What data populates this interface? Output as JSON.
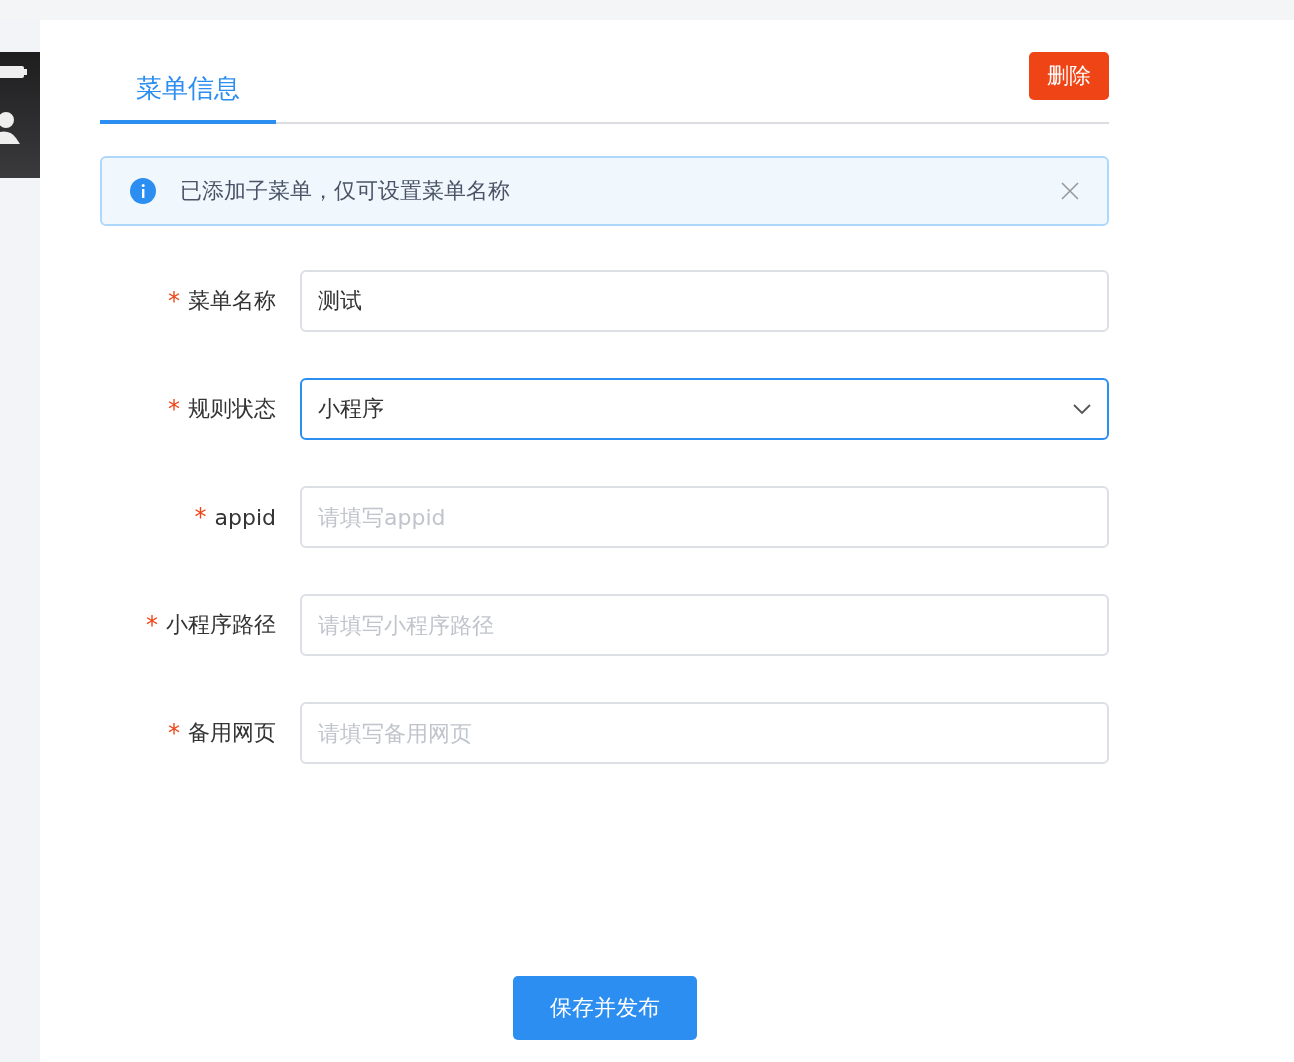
{
  "tabs": [
    {
      "label": "菜单信息",
      "selected": true
    }
  ],
  "delete_button": "删除",
  "alert": {
    "text": "已添加子菜单，仅可设置菜单名称",
    "closable": true
  },
  "fields": [
    {
      "kind": "text",
      "label": "菜单名称",
      "required_mark": "*",
      "value": "测试",
      "focused": false
    },
    {
      "kind": "select",
      "label": "规则状态",
      "required_mark": "*",
      "value": "小程序",
      "focused": true
    },
    {
      "kind": "text",
      "label": "appid",
      "required_mark": "*",
      "placeholder": "请填写appid",
      "focused": false
    },
    {
      "kind": "text",
      "label": "小程序路径",
      "required_mark": "*",
      "placeholder": "请填写小程序路径",
      "focused": false
    },
    {
      "kind": "text",
      "label": "备用网页",
      "required_mark": "*",
      "placeholder": "请填写备用网页",
      "focused": false
    }
  ],
  "submit_button": "保存并发布"
}
